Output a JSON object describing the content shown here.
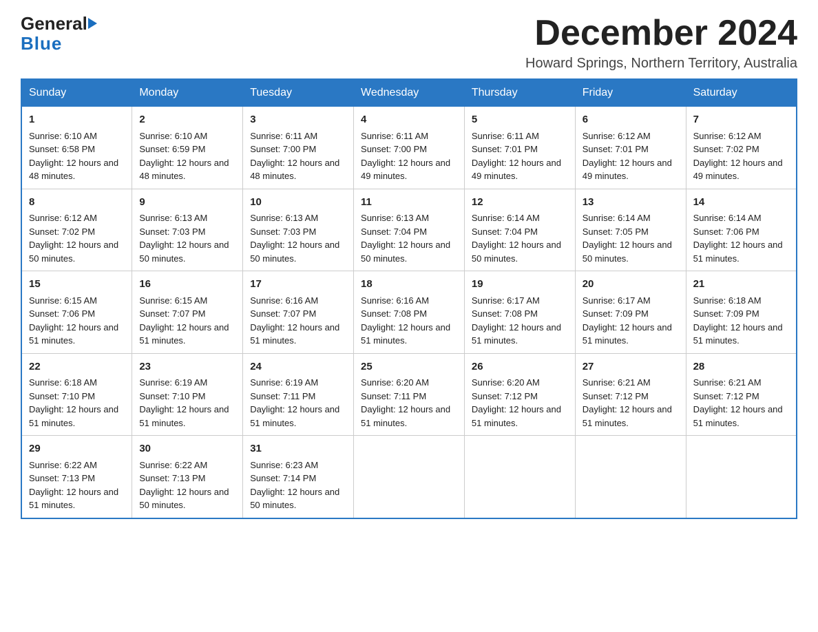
{
  "header": {
    "logo_general": "General",
    "logo_blue": "Blue",
    "month_title": "December 2024",
    "location": "Howard Springs, Northern Territory, Australia"
  },
  "days_of_week": [
    "Sunday",
    "Monday",
    "Tuesday",
    "Wednesday",
    "Thursday",
    "Friday",
    "Saturday"
  ],
  "weeks": [
    [
      {
        "num": "1",
        "sunrise": "6:10 AM",
        "sunset": "6:58 PM",
        "daylight": "12 hours and 48 minutes."
      },
      {
        "num": "2",
        "sunrise": "6:10 AM",
        "sunset": "6:59 PM",
        "daylight": "12 hours and 48 minutes."
      },
      {
        "num": "3",
        "sunrise": "6:11 AM",
        "sunset": "7:00 PM",
        "daylight": "12 hours and 48 minutes."
      },
      {
        "num": "4",
        "sunrise": "6:11 AM",
        "sunset": "7:00 PM",
        "daylight": "12 hours and 49 minutes."
      },
      {
        "num": "5",
        "sunrise": "6:11 AM",
        "sunset": "7:01 PM",
        "daylight": "12 hours and 49 minutes."
      },
      {
        "num": "6",
        "sunrise": "6:12 AM",
        "sunset": "7:01 PM",
        "daylight": "12 hours and 49 minutes."
      },
      {
        "num": "7",
        "sunrise": "6:12 AM",
        "sunset": "7:02 PM",
        "daylight": "12 hours and 49 minutes."
      }
    ],
    [
      {
        "num": "8",
        "sunrise": "6:12 AM",
        "sunset": "7:02 PM",
        "daylight": "12 hours and 50 minutes."
      },
      {
        "num": "9",
        "sunrise": "6:13 AM",
        "sunset": "7:03 PM",
        "daylight": "12 hours and 50 minutes."
      },
      {
        "num": "10",
        "sunrise": "6:13 AM",
        "sunset": "7:03 PM",
        "daylight": "12 hours and 50 minutes."
      },
      {
        "num": "11",
        "sunrise": "6:13 AM",
        "sunset": "7:04 PM",
        "daylight": "12 hours and 50 minutes."
      },
      {
        "num": "12",
        "sunrise": "6:14 AM",
        "sunset": "7:04 PM",
        "daylight": "12 hours and 50 minutes."
      },
      {
        "num": "13",
        "sunrise": "6:14 AM",
        "sunset": "7:05 PM",
        "daylight": "12 hours and 50 minutes."
      },
      {
        "num": "14",
        "sunrise": "6:14 AM",
        "sunset": "7:06 PM",
        "daylight": "12 hours and 51 minutes."
      }
    ],
    [
      {
        "num": "15",
        "sunrise": "6:15 AM",
        "sunset": "7:06 PM",
        "daylight": "12 hours and 51 minutes."
      },
      {
        "num": "16",
        "sunrise": "6:15 AM",
        "sunset": "7:07 PM",
        "daylight": "12 hours and 51 minutes."
      },
      {
        "num": "17",
        "sunrise": "6:16 AM",
        "sunset": "7:07 PM",
        "daylight": "12 hours and 51 minutes."
      },
      {
        "num": "18",
        "sunrise": "6:16 AM",
        "sunset": "7:08 PM",
        "daylight": "12 hours and 51 minutes."
      },
      {
        "num": "19",
        "sunrise": "6:17 AM",
        "sunset": "7:08 PM",
        "daylight": "12 hours and 51 minutes."
      },
      {
        "num": "20",
        "sunrise": "6:17 AM",
        "sunset": "7:09 PM",
        "daylight": "12 hours and 51 minutes."
      },
      {
        "num": "21",
        "sunrise": "6:18 AM",
        "sunset": "7:09 PM",
        "daylight": "12 hours and 51 minutes."
      }
    ],
    [
      {
        "num": "22",
        "sunrise": "6:18 AM",
        "sunset": "7:10 PM",
        "daylight": "12 hours and 51 minutes."
      },
      {
        "num": "23",
        "sunrise": "6:19 AM",
        "sunset": "7:10 PM",
        "daylight": "12 hours and 51 minutes."
      },
      {
        "num": "24",
        "sunrise": "6:19 AM",
        "sunset": "7:11 PM",
        "daylight": "12 hours and 51 minutes."
      },
      {
        "num": "25",
        "sunrise": "6:20 AM",
        "sunset": "7:11 PM",
        "daylight": "12 hours and 51 minutes."
      },
      {
        "num": "26",
        "sunrise": "6:20 AM",
        "sunset": "7:12 PM",
        "daylight": "12 hours and 51 minutes."
      },
      {
        "num": "27",
        "sunrise": "6:21 AM",
        "sunset": "7:12 PM",
        "daylight": "12 hours and 51 minutes."
      },
      {
        "num": "28",
        "sunrise": "6:21 AM",
        "sunset": "7:12 PM",
        "daylight": "12 hours and 51 minutes."
      }
    ],
    [
      {
        "num": "29",
        "sunrise": "6:22 AM",
        "sunset": "7:13 PM",
        "daylight": "12 hours and 51 minutes."
      },
      {
        "num": "30",
        "sunrise": "6:22 AM",
        "sunset": "7:13 PM",
        "daylight": "12 hours and 50 minutes."
      },
      {
        "num": "31",
        "sunrise": "6:23 AM",
        "sunset": "7:14 PM",
        "daylight": "12 hours and 50 minutes."
      },
      null,
      null,
      null,
      null
    ]
  ]
}
